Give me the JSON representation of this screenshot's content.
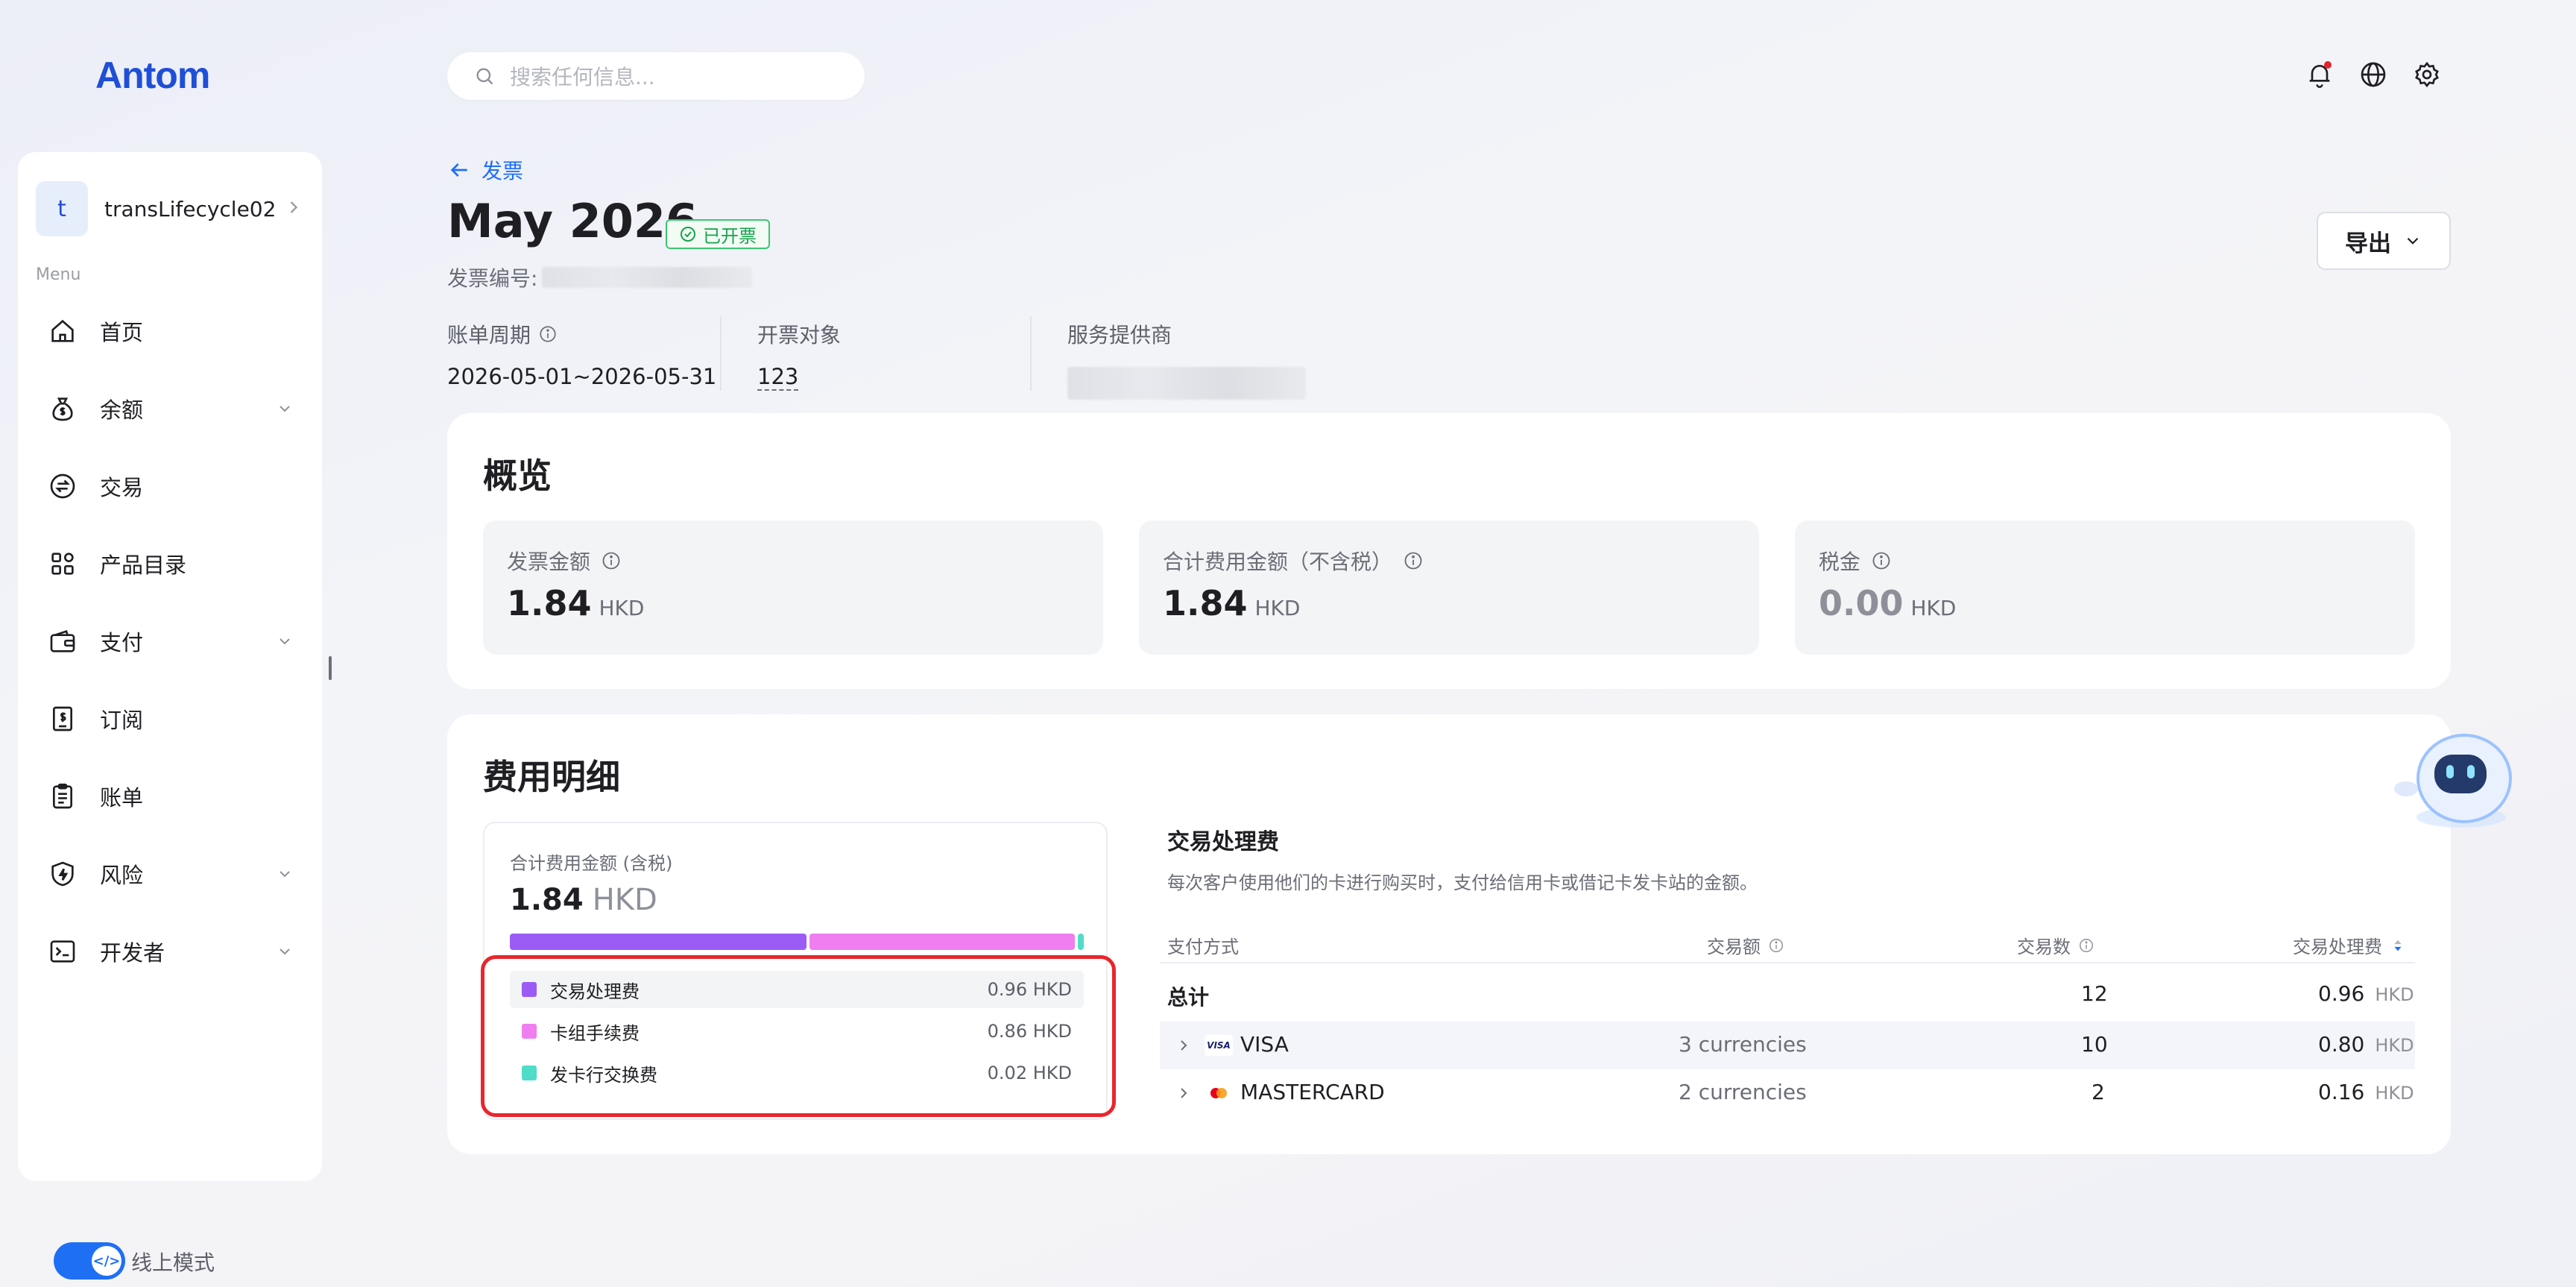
{
  "app": {
    "logo": "Antom"
  },
  "search": {
    "placeholder": "搜索任何信息..."
  },
  "sidebar": {
    "account": {
      "initial": "t",
      "name": "transLifecycle02"
    },
    "menu_label": "Menu",
    "items": [
      {
        "label": "首页",
        "icon": "home-icon",
        "expandable": false
      },
      {
        "label": "余额",
        "icon": "money-bag-icon",
        "expandable": true
      },
      {
        "label": "交易",
        "icon": "exchange-icon",
        "expandable": false
      },
      {
        "label": "产品目录",
        "icon": "grid-icon",
        "expandable": false
      },
      {
        "label": "支付",
        "icon": "wallet-icon",
        "expandable": true
      },
      {
        "label": "订阅",
        "icon": "subscription-icon",
        "expandable": false
      },
      {
        "label": "账单",
        "icon": "bill-icon",
        "expandable": false
      },
      {
        "label": "风险",
        "icon": "shield-icon",
        "expandable": true
      },
      {
        "label": "开发者",
        "icon": "terminal-icon",
        "expandable": true
      }
    ],
    "mode_toggle": {
      "label": "线上模式",
      "on": true
    }
  },
  "header": {
    "back_label": "发票",
    "title": "May 2026",
    "status": "已开票",
    "invoice_no_label": "发票编号:",
    "meta": [
      {
        "label": "账单周期",
        "value": "2026-05-01~2026-05-31"
      },
      {
        "label": "开票对象",
        "value": "123"
      },
      {
        "label": "服务提供商",
        "value": ""
      }
    ],
    "export_label": "导出"
  },
  "overview": {
    "title": "概览",
    "boxes": [
      {
        "label": "发票金额",
        "value": "1.84",
        "currency": "HKD"
      },
      {
        "label": "合计费用金额（不含税）",
        "value": "1.84",
        "currency": "HKD"
      },
      {
        "label": "税金",
        "value": "0.00",
        "currency": "HKD"
      }
    ]
  },
  "fee_detail": {
    "title": "费用明细",
    "total_label": "合计费用金额 (含税)",
    "total_value": "1.84",
    "total_currency": "HKD",
    "breakdown": [
      {
        "name": "交易处理费",
        "value": "0.96 HKD",
        "amount": 0.96,
        "color": "#9b5cf6"
      },
      {
        "name": "卡组手续费",
        "value": "0.86 HKD",
        "amount": 0.86,
        "color": "#f07ef0"
      },
      {
        "name": "发卡行交换费",
        "value": "0.02 HKD",
        "amount": 0.02,
        "color": "#4fdcc8"
      }
    ],
    "table": {
      "title": "交易处理费",
      "description": "每次客户使用他们的卡进行购买时，支付给信用卡或借记卡发卡站的金额。",
      "headers": {
        "method": "支付方式",
        "amount": "交易额",
        "count": "交易数",
        "fee": "交易处理费"
      },
      "total": {
        "label": "总计",
        "count": "12",
        "fee": "0.96",
        "currency": "HKD"
      },
      "rows": [
        {
          "brand": "VISA",
          "icon": "visa-icon",
          "amount": "3 currencies",
          "count": "10",
          "fee": "0.80",
          "currency": "HKD"
        },
        {
          "brand": "MASTERCARD",
          "icon": "mastercard-icon",
          "amount": "2 currencies",
          "count": "2",
          "fee": "0.16",
          "currency": "HKD"
        }
      ]
    }
  },
  "colors": {
    "accent": "#1f6ff5",
    "status_green": "#16a34a",
    "highlight_red": "#e8262c"
  }
}
